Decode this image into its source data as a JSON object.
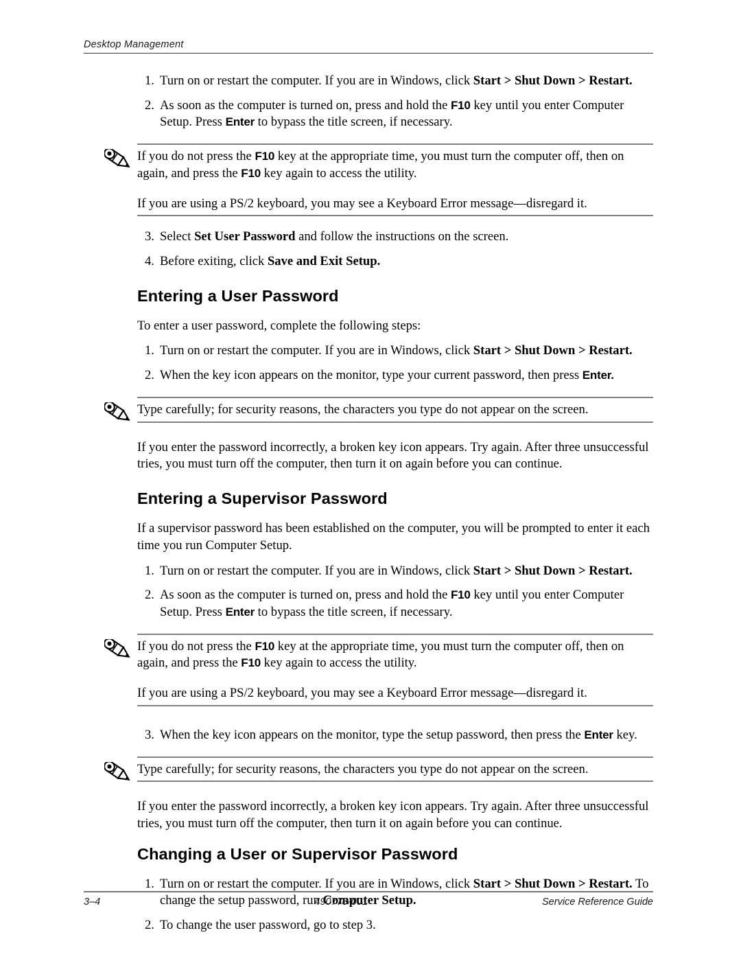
{
  "header": {
    "section_label": "Desktop Management"
  },
  "footer": {
    "page_number": "3–4",
    "part_number": "490778-001",
    "guide_title": "Service Reference Guide"
  },
  "icons": {
    "note_pencil": "pencil-note-icon"
  },
  "blocks": {
    "top_steps": [
      {
        "num": "1.",
        "text_runs": [
          {
            "t": "Turn on or restart the computer. If you are in Windows, click ",
            "style": "normal"
          },
          {
            "t": "Start > Shut Down > Restart.",
            "style": "bold-serif"
          }
        ]
      },
      {
        "num": "2.",
        "text_runs": [
          {
            "t": "As soon as the computer is turned on, press and hold the ",
            "style": "normal"
          },
          {
            "t": "F10",
            "style": "bold-sans"
          },
          {
            "t": " key until you enter Computer Setup. Press ",
            "style": "normal"
          },
          {
            "t": "Enter",
            "style": "bold-sans"
          },
          {
            "t": " to bypass the title screen, if necessary.",
            "style": "normal"
          }
        ]
      }
    ],
    "note_f10_runs_line1": [
      {
        "t": "If you do not press the ",
        "style": "normal"
      },
      {
        "t": "F10",
        "style": "bold-sans"
      },
      {
        "t": " key at the appropriate time, you must turn the computer off, then on again, and press the ",
        "style": "normal"
      },
      {
        "t": "F10",
        "style": "bold-sans"
      },
      {
        "t": " key again to access the utility.",
        "style": "normal"
      }
    ],
    "note_f10_line2": "If you are using a PS/2 keyboard, you may see a Keyboard Error message—disregard it.",
    "set_user_steps": [
      {
        "num": "3.",
        "text_runs": [
          {
            "t": "Select ",
            "style": "normal"
          },
          {
            "t": "Set User Password",
            "style": "bold-serif"
          },
          {
            "t": " and follow the instructions on the screen.",
            "style": "normal"
          }
        ]
      },
      {
        "num": "4.",
        "text_runs": [
          {
            "t": "Before exiting, click ",
            "style": "normal"
          },
          {
            "t": "Save and Exit Setup.",
            "style": "bold-serif"
          }
        ]
      }
    ],
    "section_user": {
      "heading": "Entering a User Password",
      "intro": "To enter a user password, complete the following steps:",
      "steps": [
        {
          "num": "1.",
          "text_runs": [
            {
              "t": "Turn on or restart the computer. If you are in Windows, click ",
              "style": "normal"
            },
            {
              "t": "Start > Shut Down > Restart.",
              "style": "bold-serif"
            }
          ]
        },
        {
          "num": "2.",
          "text_runs": [
            {
              "t": "When the key icon appears on the monitor, type your current password, then press ",
              "style": "normal"
            },
            {
              "t": "Enter.",
              "style": "bold-sans"
            }
          ]
        }
      ],
      "note": "Type carefully; for security reasons, the characters you type do not appear on the screen.",
      "after_note": "If you enter the password incorrectly, a broken key icon appears. Try again. After three unsuccessful tries, you must turn off the computer, then turn it on again before you can continue."
    },
    "section_supervisor": {
      "heading": "Entering a Supervisor Password",
      "intro": "If a supervisor password has been established on the computer, you will be prompted to enter it each time you run Computer Setup.",
      "steps": [
        {
          "num": "1.",
          "text_runs": [
            {
              "t": "Turn on or restart the computer. If you are in Windows, click ",
              "style": "normal"
            },
            {
              "t": "Start > Shut Down > Restart.",
              "style": "bold-serif"
            }
          ]
        },
        {
          "num": "2.",
          "text_runs": [
            {
              "t": "As soon as the computer is turned on, press and hold the ",
              "style": "normal"
            },
            {
              "t": "F10",
              "style": "bold-sans"
            },
            {
              "t": " key until you enter Computer Setup. Press ",
              "style": "normal"
            },
            {
              "t": "Enter",
              "style": "bold-sans"
            },
            {
              "t": " to bypass the title screen, if necessary.",
              "style": "normal"
            }
          ]
        }
      ],
      "note_line1_runs": [
        {
          "t": "If you do not press the ",
          "style": "normal"
        },
        {
          "t": "F10",
          "style": "bold-sans"
        },
        {
          "t": " key at the appropriate time, you must turn the computer off, then on again, and press the ",
          "style": "normal"
        },
        {
          "t": "F10",
          "style": "bold-sans"
        },
        {
          "t": " key again to access the utility.",
          "style": "normal"
        }
      ],
      "note_line2": "If you are using a PS/2 keyboard, you may see a Keyboard Error message—disregard it.",
      "step3": {
        "num": "3.",
        "text_runs": [
          {
            "t": "When the key icon appears on the monitor, type the setup password, then press the ",
            "style": "normal"
          },
          {
            "t": "Enter",
            "style": "bold-sans"
          },
          {
            "t": " key.",
            "style": "normal"
          }
        ]
      },
      "note2": "Type carefully; for security reasons, the characters you type do not appear on the screen.",
      "after_note2": "If you enter the password incorrectly, a broken key icon appears. Try again. After three unsuccessful tries, you must turn off the computer, then turn it on again before you can continue."
    },
    "section_changing": {
      "heading": "Changing a User or Supervisor Password",
      "steps": [
        {
          "num": "1.",
          "text_runs": [
            {
              "t": "Turn on or restart the computer. If you are in Windows, click ",
              "style": "normal"
            },
            {
              "t": "Start > Shut Down > Restart.",
              "style": "bold-serif"
            },
            {
              "t": " To change the setup password, run ",
              "style": "normal"
            },
            {
              "t": "Computer Setup.",
              "style": "bold-serif"
            }
          ]
        },
        {
          "num": "2.",
          "text_runs": [
            {
              "t": "To change the user password, go to step 3.",
              "style": "normal"
            }
          ]
        }
      ]
    }
  },
  "colors": {
    "text": "#000000",
    "rule_gray": "#808080",
    "header_rule": "#3c3c3c",
    "footer_rule": "#757575"
  }
}
